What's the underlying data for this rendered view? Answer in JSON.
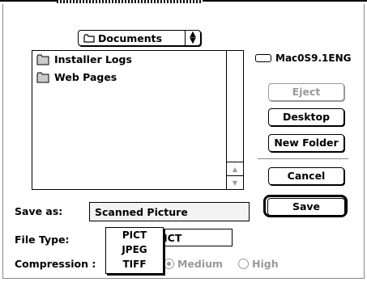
{
  "navigation": {
    "folder_popup": "Documents",
    "volume_name": "Mac0S9.1ENG"
  },
  "file_list": {
    "items": [
      {
        "name": "Installer Logs"
      },
      {
        "name": "Web Pages"
      }
    ]
  },
  "buttons": {
    "eject": "Eject",
    "desktop": "Desktop",
    "new_folder": "New Folder",
    "cancel": "Cancel",
    "save": "Save"
  },
  "save_as": {
    "label": "Save as:",
    "value": "Scanned Picture"
  },
  "file_type": {
    "label": "File Type:",
    "selected_partial": "ICT",
    "menu_options": [
      "PICT",
      "JPEG",
      "TIFF"
    ]
  },
  "compression": {
    "label": "Compression :",
    "options": [
      "Medium",
      "High"
    ]
  }
}
